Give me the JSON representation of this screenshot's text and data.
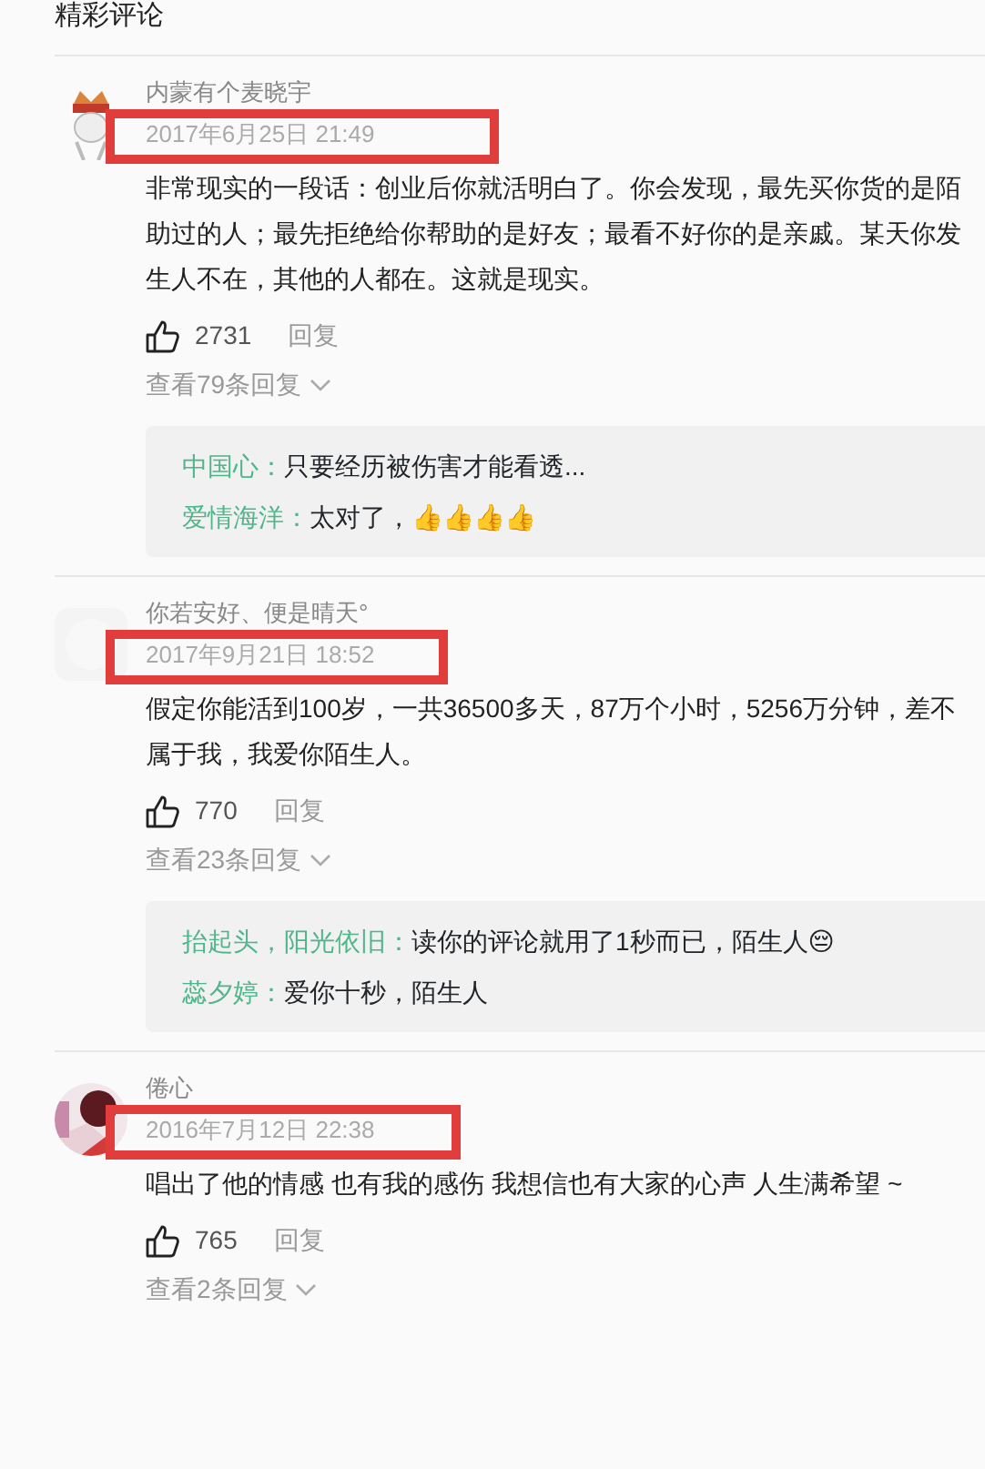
{
  "heading": "精彩评论",
  "comments": [
    {
      "author": "内蒙有个麦晓宇",
      "time": "2017年6月25日 21:49",
      "avatar": {
        "kind": "picture"
      },
      "highlighted": true,
      "body_lines": [
        "非常现实的一段话：创业后你就活明白了。你会发现，最先买你货的是陌",
        "助过的人；最先拒绝给你帮助的是好友；最看不好你的是亲戚。某天你发",
        "生人不在，其他的人都在。这就是现实。"
      ],
      "likes": "2731",
      "reply_label": "回复",
      "view_replies": "查看79条回复",
      "replies": [
        {
          "author": "中国心：",
          "text": "只要经历被伤害才能看透..."
        },
        {
          "author": "爱情海洋：",
          "text": "太对了，👍👍👍👍"
        }
      ]
    },
    {
      "author": "你若安好、便是晴天°",
      "time": "2017年9月21日 18:52",
      "avatar": {
        "kind": "picture"
      },
      "highlighted": true,
      "body_lines": [
        "假定你能活到100岁，一共36500多天，87万个小时，5256万分钟，差不",
        "属于我，我爱你陌生人。"
      ],
      "likes": "770",
      "reply_label": "回复",
      "view_replies": "查看23条回复",
      "replies": [
        {
          "author": "抬起头，阳光依旧：",
          "text": "读你的评论就用了1秒而已，陌生人😔"
        },
        {
          "author": "蕊夕婷：",
          "text": "爱你十秒，陌生人"
        }
      ]
    },
    {
      "author": "倦心",
      "time": "2016年7月12日 22:38",
      "avatar": {
        "kind": "picture"
      },
      "highlighted": true,
      "body_lines": [
        "唱出了他的情感 也有我的感伤 我想信也有大家的心声 人生满希望 ~"
      ],
      "likes": "765",
      "reply_label": "回复",
      "view_replies": "查看2条回复"
    }
  ]
}
